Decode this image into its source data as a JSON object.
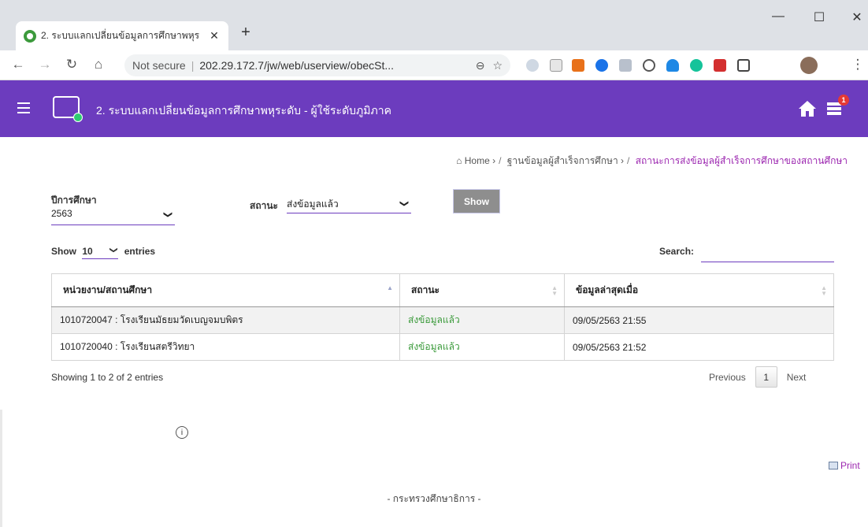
{
  "browser": {
    "tab_title": "2. ระบบแลกเปลี่ยนข้อมูลการศึกษาพหุร",
    "tab_close": "✕",
    "new_tab": "+",
    "minimize": "—",
    "maximize": "☐",
    "close": "✕",
    "security": "Not secure",
    "url": "202.29.172.7/jw/web/userview/obecSt...",
    "back": "←",
    "forward": "→",
    "reload": "↻",
    "home": "⌂",
    "zoom": "🔍",
    "star": "☆",
    "menu": "⋮"
  },
  "header": {
    "title": "2. ระบบแลกเปลี่ยนข้อมูลการศึกษาพหุระดับ - ผู้ใช้ระดับภูมิภาค",
    "notification_count": "1",
    "bg_color": "#6c3cbe"
  },
  "breadcrumb": {
    "home": "Home",
    "item1": "ฐานข้อมูลผู้สำเร็จการศึกษา",
    "current": "สถานะการส่งข้อมูลผู้สำเร็จการศึกษาของสถานศึกษา",
    "sep": "/",
    "arrow": "›"
  },
  "filters": {
    "year_label": "ปีการศึกษา",
    "year_value": "2563",
    "status_label": "สถานะ",
    "status_value": "ส่งข้อมูลแล้ว",
    "show_button": "Show",
    "chevron": "❯"
  },
  "table_controls": {
    "show": "Show",
    "length_value": "10",
    "entries": "entries",
    "search_label": "Search:"
  },
  "table": {
    "columns": [
      "หน่วยงาน/สถานศึกษา",
      "สถานะ",
      "ข้อมูลล่าสุดเมื่อ"
    ],
    "rows": [
      [
        "1010720047 : โรงเรียนมัธยมวัดเบญจมบพิตร",
        "ส่งข้อมูลแล้ว",
        "09/05/2563 21:55"
      ],
      [
        "1010720040 : โรงเรียนสตรีวิทยา",
        "ส่งข้อมูลแล้ว",
        "09/05/2563 21:52"
      ]
    ],
    "sort_up": "▲",
    "sort_down": "▼"
  },
  "pagination": {
    "info": "Showing 1 to 2 of 2 entries",
    "previous": "Previous",
    "page": "1",
    "next": "Next"
  },
  "print_label": "Print",
  "footer": "- กระทรวงศึกษาธิการ -"
}
